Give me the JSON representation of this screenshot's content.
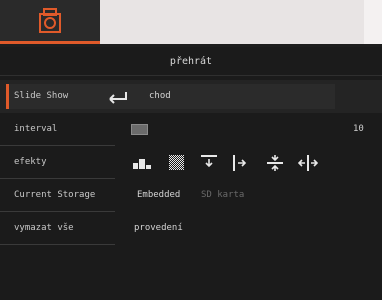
{
  "header": {
    "home_icon": "camera-icon",
    "accent_color": "#e05a2a"
  },
  "page": {
    "title": "přehrát"
  },
  "menu": {
    "slideshow": {
      "label": "Slide Show",
      "value": "chod",
      "icon": "enter-return-icon"
    },
    "interval": {
      "label": "interval",
      "value": "10"
    },
    "effects": {
      "label": "efekty",
      "items": [
        "blocks-effect-icon",
        "dissolve-effect-icon",
        "wipe-down-effect-icon",
        "slide-right-effect-icon",
        "split-vertical-effect-icon",
        "split-horizontal-effect-icon"
      ]
    },
    "storage": {
      "label": "Current Storage",
      "options": [
        "Embedded",
        "SD karta"
      ],
      "selected": "Embedded"
    },
    "erase": {
      "label": "vymazat vše",
      "value": "provedení"
    }
  }
}
